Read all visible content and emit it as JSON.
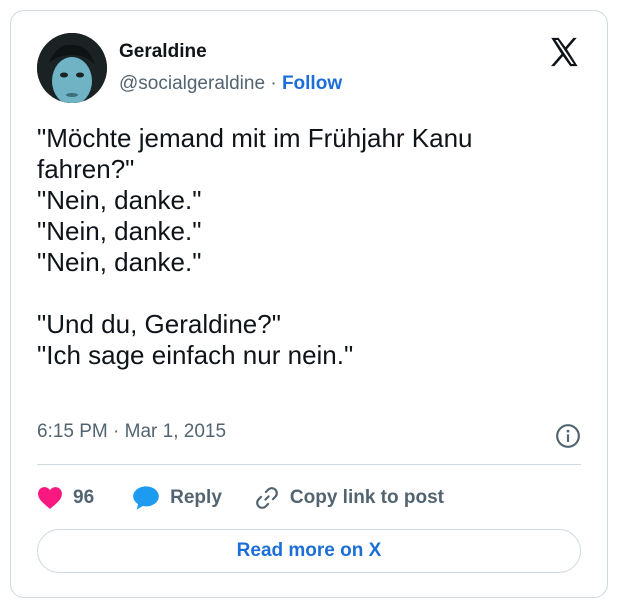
{
  "author": {
    "name": "Geraldine",
    "handle": "@socialgeraldine",
    "separator": "·",
    "follow_label": "Follow"
  },
  "tweet": {
    "text": "\"Möchte jemand mit im Frühjahr Kanu fahren?\"\n\"Nein, danke.\"\n\"Nein, danke.\"\n\"Nein, danke.\"\n\n\"Und du, Geraldine?\"\n\"Ich sage einfach nur nein.\"",
    "timestamp": "6:15 PM · Mar 1, 2015"
  },
  "actions": {
    "likes_count": "96",
    "reply_label": "Reply",
    "copy_link_label": "Copy link to post"
  },
  "read_more_label": "Read more on X",
  "icons": {
    "brand": "x-logo-icon",
    "info": "info-icon",
    "like": "heart-icon",
    "reply": "speech-bubble-icon",
    "copy": "link-icon"
  },
  "colors": {
    "accent": "#1d6fd8",
    "like": "#f91880",
    "reply": "#1d9bf0",
    "muted": "#536471",
    "border": "#cfd9de"
  }
}
